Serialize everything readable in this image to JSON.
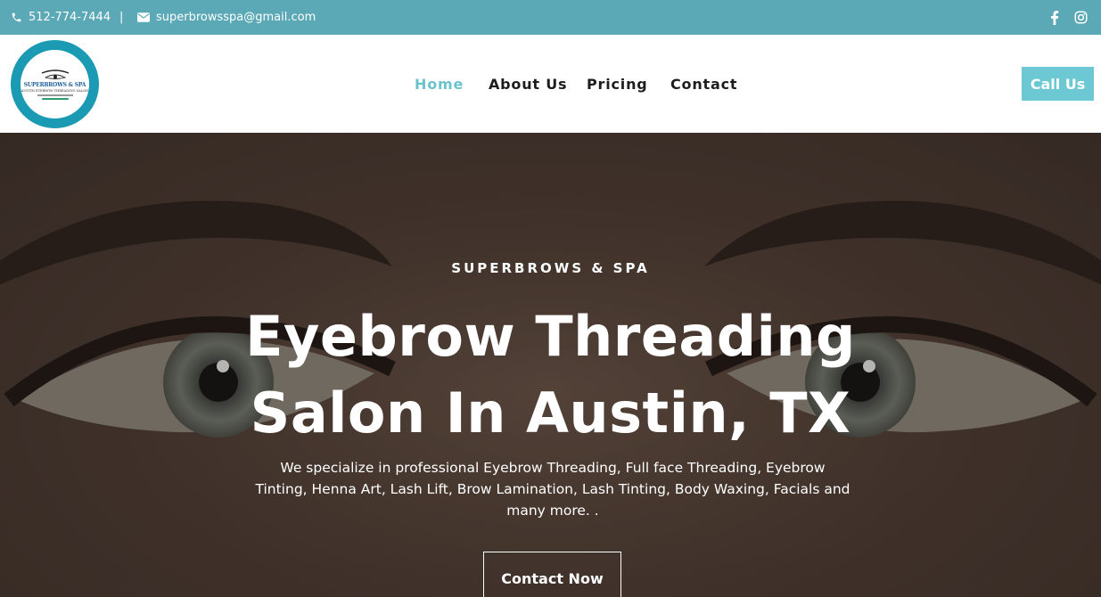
{
  "topbar": {
    "phone": "512-774-7444",
    "separator": "|",
    "email": "superbrowsspa@gmail.com",
    "background": "#5ba8b6",
    "icons": [
      "phone-icon",
      "envelope-icon",
      "facebook-icon",
      "instagram-icon"
    ]
  },
  "logo": {
    "line1": "SUPERBROWS & SPA",
    "line2": "AUSTIN EYEBROW THREADING SALON",
    "ring_color": "#1b9bb3"
  },
  "nav": {
    "items": [
      {
        "label": "Home",
        "active": true
      },
      {
        "label": "About Us",
        "active": false
      },
      {
        "label": "Pricing",
        "active": false
      },
      {
        "label": "Contact",
        "active": false
      }
    ],
    "active_color": "#6cc3cd"
  },
  "header": {
    "call_label": "Call Us",
    "call_color": "#6cc9d3"
  },
  "hero": {
    "kicker": "SUPERBROWS & SPA",
    "headline_line1": "Eyebrow Threading",
    "headline_line2": "Salon In Austin, TX",
    "description": "We specialize in professional Eyebrow Threading, Full face Threading, Eyebrow Tinting, Henna Art, Lash Lift, Brow Lamination, Lash Tinting, Body Waxing, Facials and many more. .",
    "cta_label": "Contact Now"
  }
}
